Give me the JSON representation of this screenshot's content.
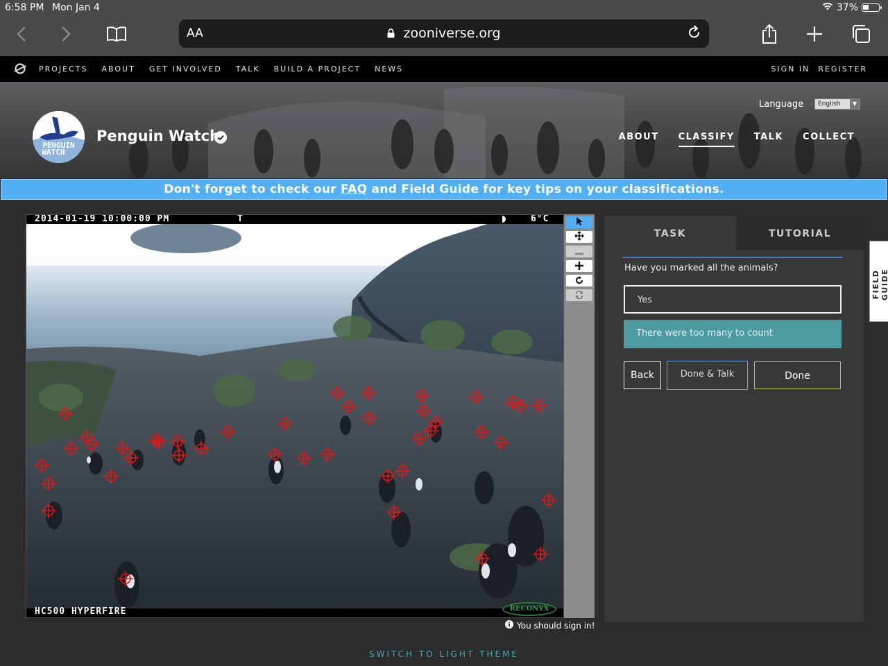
{
  "status_bar": {
    "time": "6:58 PM",
    "date": "Mon Jan 4",
    "battery": "37%"
  },
  "browser": {
    "text_size_label": "AA",
    "url": "zooniverse.org"
  },
  "site_nav": {
    "links": [
      "PROJECTS",
      "ABOUT",
      "GET INVOLVED",
      "TALK",
      "BUILD A PROJECT",
      "NEWS"
    ],
    "sign_in": "SIGN IN",
    "register": "REGISTER"
  },
  "project": {
    "logo_text_line1": "PENGUIN",
    "logo_text_line2": "WATCH",
    "title": "Penguin Watch",
    "language_label": "Language",
    "language_value": "English",
    "nav": [
      "ABOUT",
      "CLASSIFY",
      "TALK",
      "COLLECT"
    ],
    "active_nav": "CLASSIFY"
  },
  "banner": {
    "prefix": "Don't forget to check our ",
    "link": "FAQ",
    "suffix": " and Field Guide for key tips on your classifications."
  },
  "camera": {
    "datetime": "2014-01-19 10:00:00 PM",
    "flag": "T",
    "temperature": "6°C",
    "model": "HC500 HYPERFIRE",
    "brand": "RECONYX"
  },
  "viewer_note": "You should sign in!",
  "task": {
    "tab_task": "TASK",
    "tab_tutorial": "TUTORIAL",
    "question": "Have you marked all the animals?",
    "answer_yes": "Yes",
    "answer_many": "There were too many to count",
    "back": "Back",
    "done_talk": "Done & Talk",
    "done": "Done"
  },
  "field_guide": "FIELD GUIDE",
  "theme_switch": "SWITCH TO LIGHT THEME",
  "colors": {
    "banner": "#52aff4",
    "answer_selected": "#4d9ba1",
    "marker": "#e01818",
    "tool_selected": "#52aff4"
  }
}
